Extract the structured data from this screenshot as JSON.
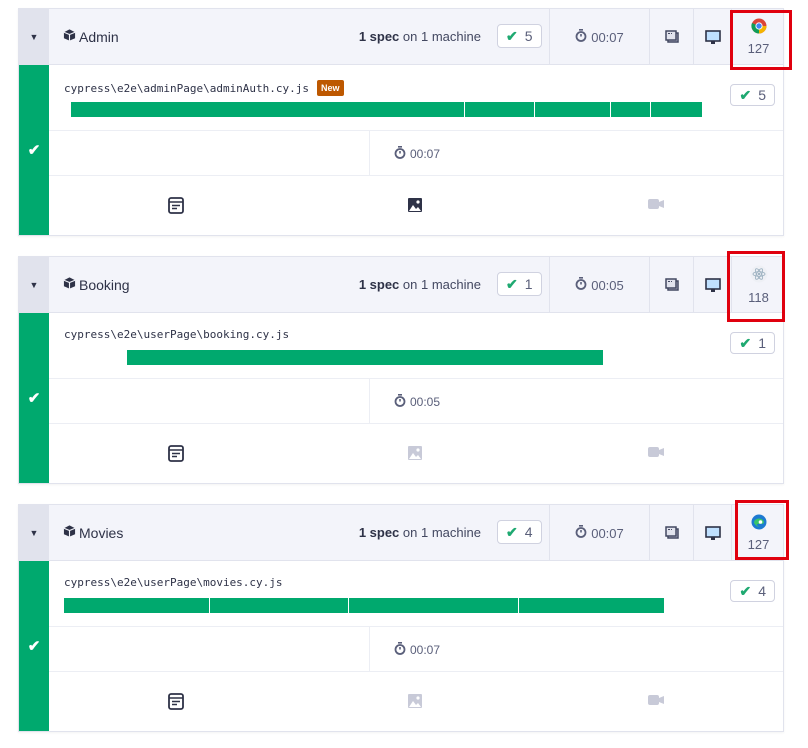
{
  "colors": {
    "pass": "#00a96e",
    "new_badge": "#bd5800",
    "highlight": "#e0000e"
  },
  "groups": [
    {
      "name": "Admin",
      "spec_count": "1 spec",
      "machine_text": "on",
      "machine_count": "1 machine",
      "passed": "5",
      "duration": "00:07",
      "browser": "chrome",
      "browser_version": "127",
      "spec_path": "cypress\\e2e\\adminPage\\adminAuth.cy.js",
      "new_badge": "New",
      "spec_passed": "5",
      "spec_duration": "00:07",
      "test_segments": [
        395,
        70,
        75,
        40,
        51
      ],
      "screenshots_available": true,
      "video_available": false
    },
    {
      "name": "Booking",
      "spec_count": "1 spec",
      "machine_text": "on",
      "machine_count": "1 machine",
      "passed": "1",
      "duration": "00:05",
      "browser": "electron",
      "browser_version": "118",
      "spec_path": "cypress\\e2e\\userPage\\booking.cy.js",
      "spec_passed": "1",
      "spec_duration": "00:05",
      "test_segments": [
        476
      ],
      "screenshots_available": false,
      "video_available": false
    },
    {
      "name": "Movies",
      "spec_count": "1 spec",
      "machine_text": "on",
      "machine_count": "1 machine",
      "passed": "4",
      "duration": "00:07",
      "browser": "edge",
      "browser_version": "127",
      "spec_path": "cypress\\e2e\\userPage\\movies.cy.js",
      "spec_passed": "4",
      "spec_duration": "00:07",
      "test_segments": [
        146,
        138,
        170,
        146
      ],
      "screenshots_available": false,
      "video_available": false
    }
  ]
}
